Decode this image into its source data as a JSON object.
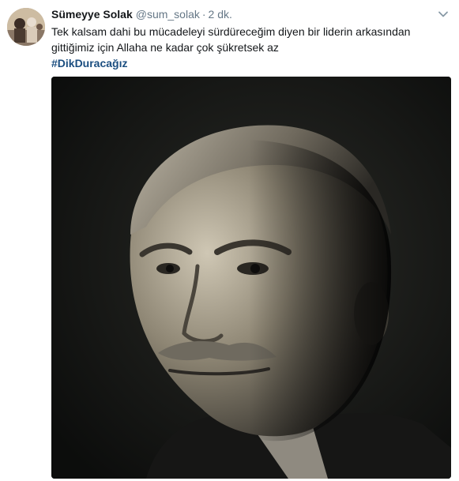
{
  "tweet": {
    "display_name": "Sümeyye Solak",
    "handle": "@sum_solak",
    "separator": "·",
    "time": "2 dk.",
    "text_line_1": "Tek kalsam dahi bu mücadeleyi sürdüreceğim diyen bir liderin arkasından",
    "text_line_2": "gittiğimiz için Allaha ne kadar çok şükretsek az",
    "hashtag": "#DikDuracağız"
  },
  "icons": {
    "avatar": "avatar",
    "more": "chevron-down-icon"
  },
  "colors": {
    "name": "#14171a",
    "meta": "#657786",
    "hashtag": "#1b4e80",
    "photo_bg": "#111312"
  }
}
